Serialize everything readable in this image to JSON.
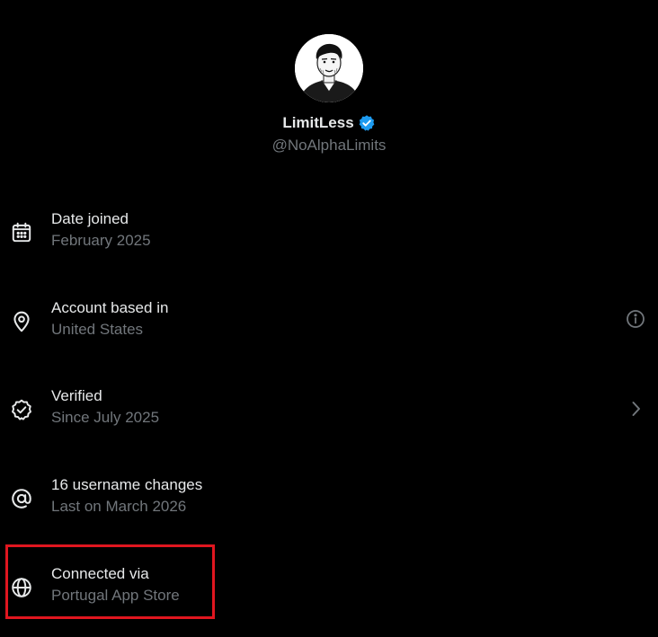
{
  "profile": {
    "display_name": "LimitLess",
    "handle": "@NoAlphaLimits",
    "verified": true,
    "badge_color": "#1d9bf0"
  },
  "rows": [
    {
      "icon": "calendar-icon",
      "label": "Date joined",
      "sub": "February 2025",
      "trailing": null
    },
    {
      "icon": "location-pin-icon",
      "label": "Account based in",
      "sub": "United States",
      "trailing": "info-icon"
    },
    {
      "icon": "verified-check-icon",
      "label": "Verified",
      "sub": "Since July 2025",
      "trailing": "chevron-right-icon"
    },
    {
      "icon": "at-sign-icon",
      "label": "16 username changes",
      "sub": "Last on March 2026",
      "trailing": null
    },
    {
      "icon": "globe-icon",
      "label": "Connected via",
      "sub": "Portugal App Store",
      "trailing": null
    }
  ],
  "colors": {
    "background": "#000000",
    "primary_text": "#e7e9ea",
    "secondary_text": "#71767b",
    "highlight": "#e0161f"
  }
}
